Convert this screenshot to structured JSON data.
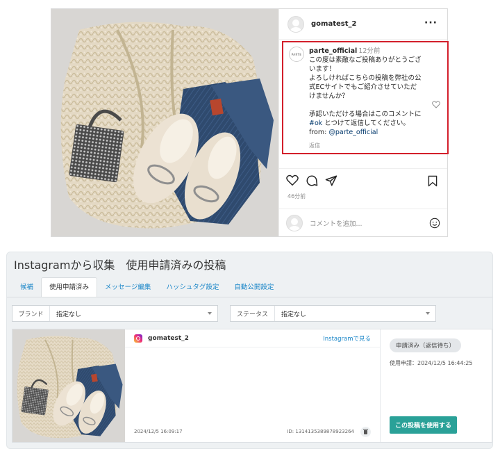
{
  "instagram": {
    "username": "gomatest_2",
    "more_icon": "···",
    "comment": {
      "logo_text": "PARTE",
      "user": "parte_official",
      "time": "12分前",
      "lines": [
        "この度は素敵なご投稿ありがとうござ",
        "います！",
        "よろしければこちらの投稿を弊社の公",
        "式ECサイトでもご紹介させていただ",
        "けませんか？"
      ],
      "approval_line": "承認いただける場合はこのコメントに",
      "tag_ok": "#ok",
      "reply_hint": " とつけて返信してください。",
      "from_label": "from: ",
      "from_tag": "@parte_official",
      "reply_label": "返信"
    },
    "post_time": "46分前",
    "add_comment_placeholder": "コメントを追加...",
    "icons": [
      "heart-icon",
      "comment-icon",
      "share-icon",
      "bookmark-icon",
      "emoji-icon"
    ]
  },
  "panel": {
    "title": "Instagramから収集　使用申請済みの投稿",
    "tabs": [
      {
        "label": "候補"
      },
      {
        "label": "使用申請済み",
        "active": true
      },
      {
        "label": "メッセージ編集"
      },
      {
        "label": "ハッシュタグ設定"
      },
      {
        "label": "自動公開設定"
      }
    ],
    "filters": {
      "brand": {
        "label": "ブランド",
        "value": "指定なし"
      },
      "status": {
        "label": "ステータス",
        "value": "指定なし"
      }
    },
    "card": {
      "username": "gomatest_2",
      "view_link": "Instagramで見る",
      "date": "2024/12/5 16:09:17",
      "post_id": "ID: 1314135389878923264",
      "status_badge": "申請済み（返信待ち）",
      "apply_date": "使用申請：2024/12/5 16:44:25",
      "use_button": "この投稿を使用する"
    }
  },
  "colors": {
    "highlight_red": "#d31f2b",
    "link_blue": "#1a86c8",
    "teal_button": "#2aa198"
  }
}
